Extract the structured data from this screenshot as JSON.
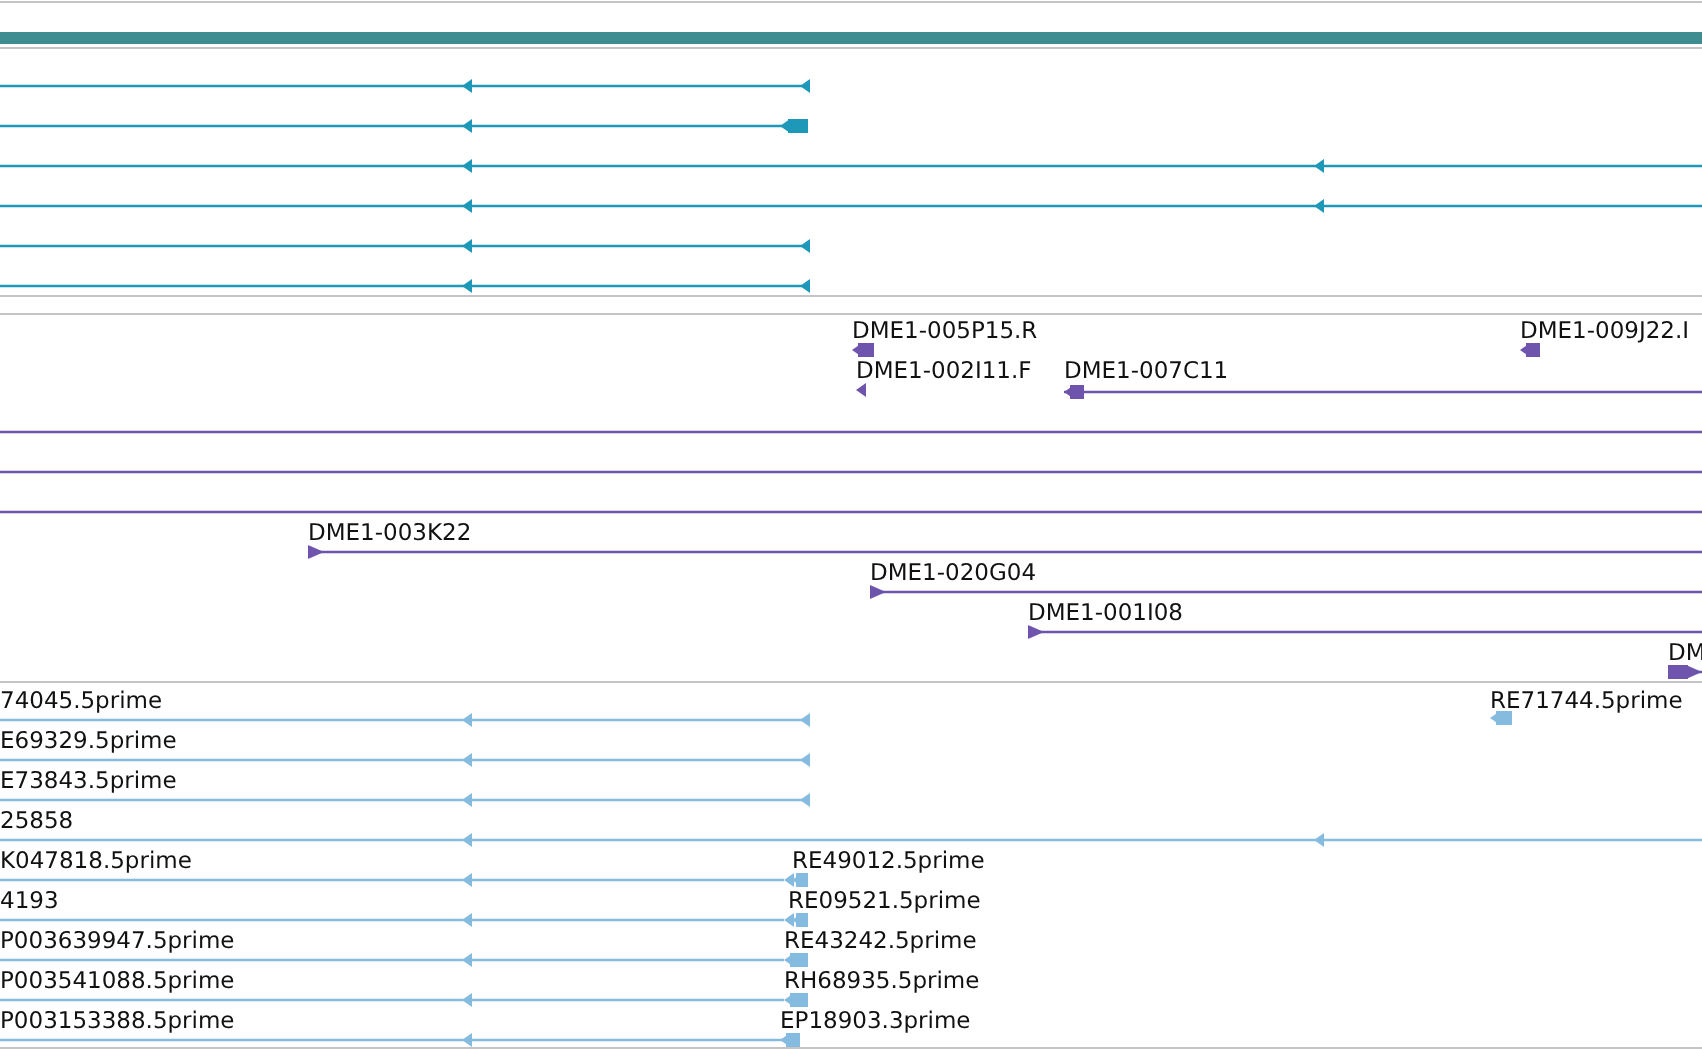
{
  "tracks": [
    {
      "kind": "gene-model",
      "color": "#1e98b8"
    },
    {
      "kind": "clones",
      "color": "#6e54ac",
      "features": [
        {
          "label": "DME1-005P15.R"
        },
        {
          "label": "DME1-009J22.I"
        },
        {
          "label": "DME1-002I11.F"
        },
        {
          "label": "DME1-007C11"
        },
        {
          "label": "DME1-003K22"
        },
        {
          "label": "DME1-020G04"
        },
        {
          "label": "DME1-001I08"
        },
        {
          "label": "DM"
        }
      ]
    },
    {
      "kind": "ests",
      "color": "#86bbe0",
      "features": [
        {
          "label": "74045.5prime"
        },
        {
          "label": "RE71744.5prime"
        },
        {
          "label": "E69329.5prime"
        },
        {
          "label": "E73843.5prime"
        },
        {
          "label": "25858"
        },
        {
          "label": "K047818.5prime"
        },
        {
          "label": "RE49012.5prime"
        },
        {
          "label": "4193"
        },
        {
          "label": "RE09521.5prime"
        },
        {
          "label": "P003639947.5prime"
        },
        {
          "label": "RE43242.5prime"
        },
        {
          "label": "P003541088.5prime"
        },
        {
          "label": "RH68935.5prime"
        },
        {
          "label": "P003153388.5prime"
        },
        {
          "label": "EP18903.3prime"
        }
      ]
    }
  ]
}
